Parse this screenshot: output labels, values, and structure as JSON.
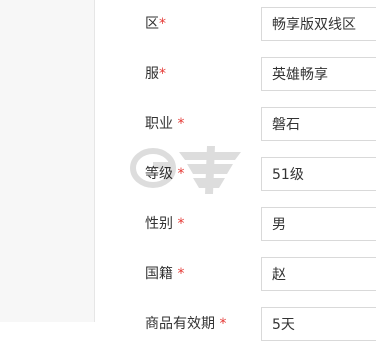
{
  "form": {
    "rows": [
      {
        "label": "区",
        "required_mark": "*",
        "value": "畅享版双线区"
      },
      {
        "label": "服",
        "required_mark": "*",
        "value": "英雄畅享"
      },
      {
        "label": "职业",
        "required_mark": " *",
        "value": "磐石"
      },
      {
        "label": "等级",
        "required_mark": " *",
        "value": "51级"
      },
      {
        "label": "性别",
        "required_mark": " *",
        "value": "男"
      },
      {
        "label": "国籍",
        "required_mark": " *",
        "value": "赵"
      },
      {
        "label": "商品有效期",
        "required_mark": " *",
        "value": "5天"
      }
    ]
  },
  "colors": {
    "required": "#e53935",
    "border": "#d9d9d9",
    "text": "#333333"
  },
  "icons": {
    "watermark": "site-logo-watermark"
  }
}
